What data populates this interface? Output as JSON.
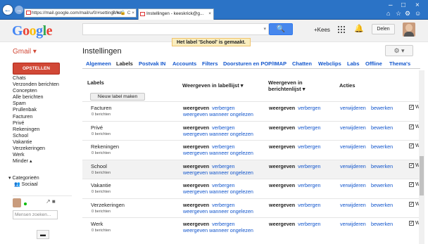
{
  "browser": {
    "url": "https://mail.google.com/mail/u/0/#settings/lab",
    "tab_title": "Instellingen - keeskrick@g...",
    "tab_close": "×",
    "back": "←",
    "forward": "→",
    "window_controls": [
      "–",
      "□",
      "×"
    ],
    "toolbar_icons": [
      "⌂",
      "☆",
      "⚙",
      "☺"
    ],
    "addr_icons": "P ▾ 🔒 C ×"
  },
  "google": {
    "logo_letters": [
      "G",
      "o",
      "o",
      "g",
      "l",
      "e"
    ],
    "search_placeholder": "",
    "search_icon": "🔍",
    "plus_user": "+Kees",
    "bell_icon": "🔔",
    "share_label": "Delen"
  },
  "gmail": {
    "brand": "Gmail ▾",
    "page_title": "Instellingen",
    "notice": "Het label 'School' is gemaakt.",
    "gear": "⚙ ▾",
    "compose": "OPSTELLEN"
  },
  "nav": {
    "items": [
      "Chats",
      "Verzonden berichten",
      "Concepten",
      "Alle berichten",
      "Spam",
      "Prullenbak",
      "Facturen",
      "Privé",
      "Rekeningen",
      "School",
      "Vakantie",
      "Verzekeringen",
      "Werk",
      "Minder ▴"
    ],
    "categories": "▾ Categorieën",
    "category_item": "👥 Sociaal",
    "chat_search": "Mensen zoeken...",
    "chat_icons": "↗  ■",
    "bottom_button": "▬"
  },
  "tabs": [
    "Algemeen",
    "Labels",
    "Postvak IN",
    "Accounts",
    "Filters",
    "Doorsturen en POP/IMAP",
    "Chatten",
    "Webclips",
    "Labs",
    "Offline",
    "Thema's"
  ],
  "active_tab": "Labels",
  "table": {
    "headers": {
      "labels": "Labels",
      "labellist": "Weergeven in labellijst ▾",
      "msglist": "Weergeven in berichtenlijst ▾",
      "actions": "Acties"
    },
    "new_label_button": "Nieuw label maken",
    "show": "weergeven",
    "hide": "verbergen",
    "show_if_unread": "weergeven wanneer ongelezen",
    "remove": "verwijderen",
    "edit": "bewerken",
    "checkbox_mark": "✓",
    "checkbox_label": "W",
    "rows": [
      {
        "name": "Facturen",
        "count": "0 berichten"
      },
      {
        "name": "Privé",
        "count": "0 berichten"
      },
      {
        "name": "Rekeningen",
        "count": "0 berichten"
      },
      {
        "name": "School",
        "count": "0 berichten"
      },
      {
        "name": "Vakantie",
        "count": "0 berichten"
      },
      {
        "name": "Verzekeringen",
        "count": "0 berichten"
      },
      {
        "name": "Werk",
        "count": "0 berichten"
      }
    ]
  }
}
